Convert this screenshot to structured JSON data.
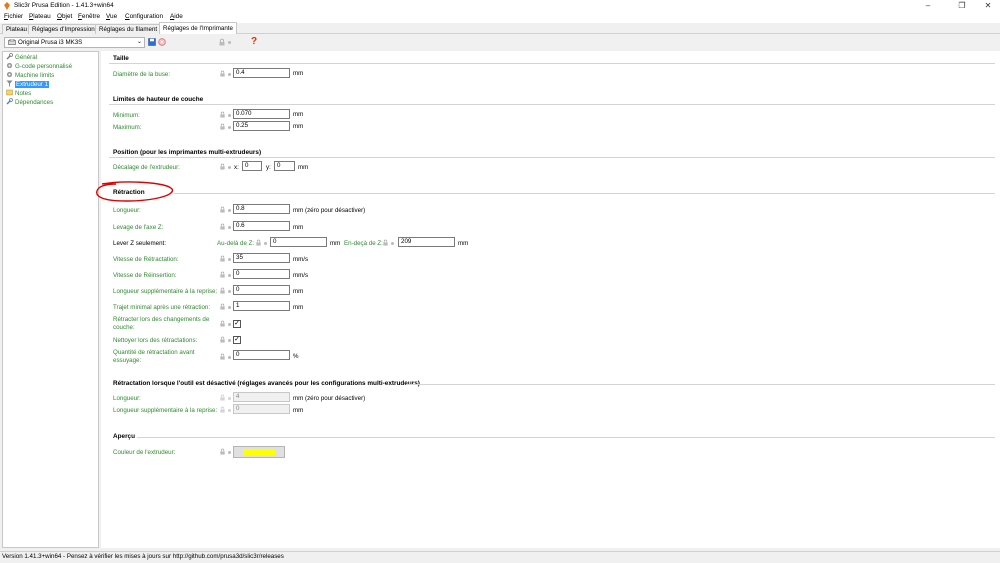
{
  "window": {
    "title": "Slic3r Prusa Edition - 1.41.3+win64"
  },
  "menu": [
    "Fichier",
    "Plateau",
    "Objet",
    "Fenêtre",
    "Vue",
    "Configuration",
    "Aide"
  ],
  "tabs": [
    "Plateau",
    "Réglages d'Impression",
    "Réglages du filament",
    "Réglages de l'Imprimante"
  ],
  "toolbar": {
    "preset": "Original Prusa i3 MK3S",
    "help_glyph": "?"
  },
  "sidebar": {
    "items": [
      {
        "label": "Général",
        "icon": "wrench-icon"
      },
      {
        "label": "G-code personnalisé",
        "icon": "cog-icon"
      },
      {
        "label": "Machine limits",
        "icon": "cog-icon"
      },
      {
        "label": "Extrudeur 1",
        "icon": "funnel-icon",
        "selected": true
      },
      {
        "label": "Notes",
        "icon": "note-icon"
      },
      {
        "label": "Dépendances",
        "icon": "wrench-icon"
      }
    ]
  },
  "sections": {
    "taille": {
      "title": "Taille",
      "nozzle_label": "Diamètre de la buse:",
      "nozzle_value": "0.4",
      "nozzle_unit": "mm"
    },
    "layer": {
      "title": "Limites de hauteur de couche",
      "min_label": "Minimum:",
      "min_value": "0.070",
      "max_label": "Maximum:",
      "max_value": "0.25",
      "unit": "mm"
    },
    "position": {
      "title": "Position (pour les imprimantes multi-extrudeurs)",
      "offset_label": "Décalage de l'extrudeur:",
      "x_label": "x:",
      "x_value": "0",
      "y_label": "y:",
      "y_value": "0",
      "unit": "mm"
    },
    "retraction": {
      "title": "Rétraction",
      "length_label": "Longueur:",
      "length_value": "0.8",
      "length_unit": "mm (zéro pour désactiver)",
      "lift_label": "Levage de l'axe Z:",
      "lift_value": "0.6",
      "lift_unit": "mm",
      "only_lift_label": "Lever Z seulement:",
      "above_label": "Au-delà de Z:",
      "above_value": "0",
      "above_unit": "mm",
      "below_label": "En-deçà de Z:",
      "below_value": "209",
      "below_unit": "mm",
      "speed_label": "Vitesse de Rétractation:",
      "speed_value": "35",
      "speed_unit": "mm/s",
      "deretract_label": "Vitesse de Réinsertion:",
      "deretract_value": "0",
      "deretract_unit": "mm/s",
      "extra_label": "Longueur supplémentaire à la reprise:",
      "extra_value": "0",
      "extra_unit": "mm",
      "min_travel_label": "Trajet minimal après une rétraction:",
      "min_travel_value": "1",
      "min_travel_unit": "mm",
      "layer_change_label_1": "Rétracter lors des changements de",
      "layer_change_label_2": "couche:",
      "layer_change_checked": true,
      "wipe_label": "Nettoyer lors des rétractations:",
      "wipe_checked": true,
      "before_wipe_label_1": "Quantité de rétractation avant",
      "before_wipe_label_2": "essuyage:",
      "before_wipe_value": "0",
      "before_wipe_unit": "%"
    },
    "toolchange": {
      "title": "Rétractation lorsque l'outil est désactivé (réglages avancés pour les configurations multi-extrudeurs)",
      "length_label": "Longueur:",
      "length_value": "4",
      "length_unit": "mm (zéro pour désactiver)",
      "extra_label": "Longueur supplémentaire à la reprise:",
      "extra_value": "0",
      "extra_unit": "mm"
    },
    "preview": {
      "title": "Aperçu",
      "color_label": "Couleur de l'extrudeur:",
      "color": "#ffff00"
    }
  },
  "status": "Version 1.41.3+win64 - Pensez à vérifier les mises à jours sur http://github.com/prusa3d/slic3r/releases",
  "colors": {
    "accent_green": "#2e8b2e",
    "annotation_red": "#e00000",
    "selection_blue": "#3399ff",
    "help_red": "#e03000"
  }
}
